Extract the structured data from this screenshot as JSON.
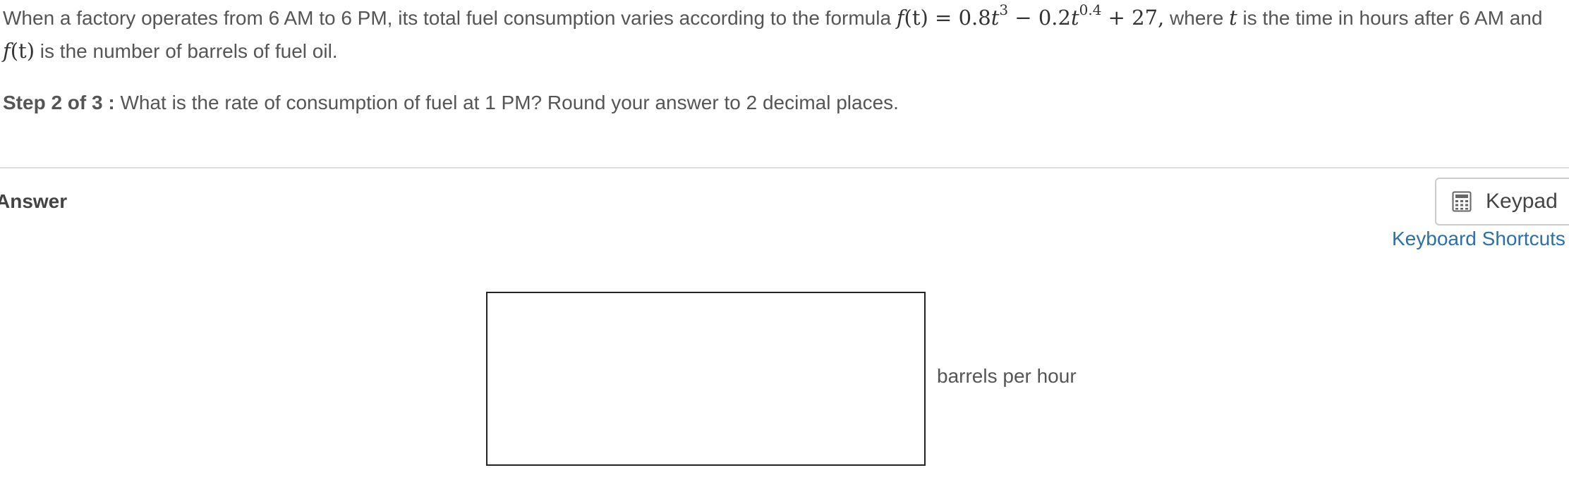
{
  "question": {
    "text_before": "When a factory operates from 6 AM to 6 PM, its total fuel consumption varies according to the formula ",
    "formula_lhs": "f",
    "formula_arg": "(t)",
    "formula_eq": " = 0.8",
    "formula_t1": "t",
    "formula_exp1": "3",
    "formula_mid": " − 0.2",
    "formula_t2": "t",
    "formula_exp2": "0.4",
    "formula_end": " + 27,",
    "text_where": " where ",
    "var_t": "t",
    "text_after": " is the time in hours after 6 AM and ",
    "f_lhs": "f",
    "f_arg": "(t)",
    "text_end": " is the number of barrels of fuel oil."
  },
  "step": {
    "label": "Step 2 of 3 :",
    "text": " What is the rate of consumption of fuel at 1 PM? Round your answer to 2 decimal places."
  },
  "answer": {
    "label": "Answer",
    "input_value": "",
    "unit": "barrels per hour"
  },
  "toolbar": {
    "keypad_label": "Keypad",
    "keypad_icon": "calculator-icon",
    "shortcuts_label": "Keyboard Shortcuts"
  },
  "colors": {
    "text": "#555555",
    "link": "#2a6fb0",
    "divider": "#dddddd",
    "input_border": "#222222"
  }
}
